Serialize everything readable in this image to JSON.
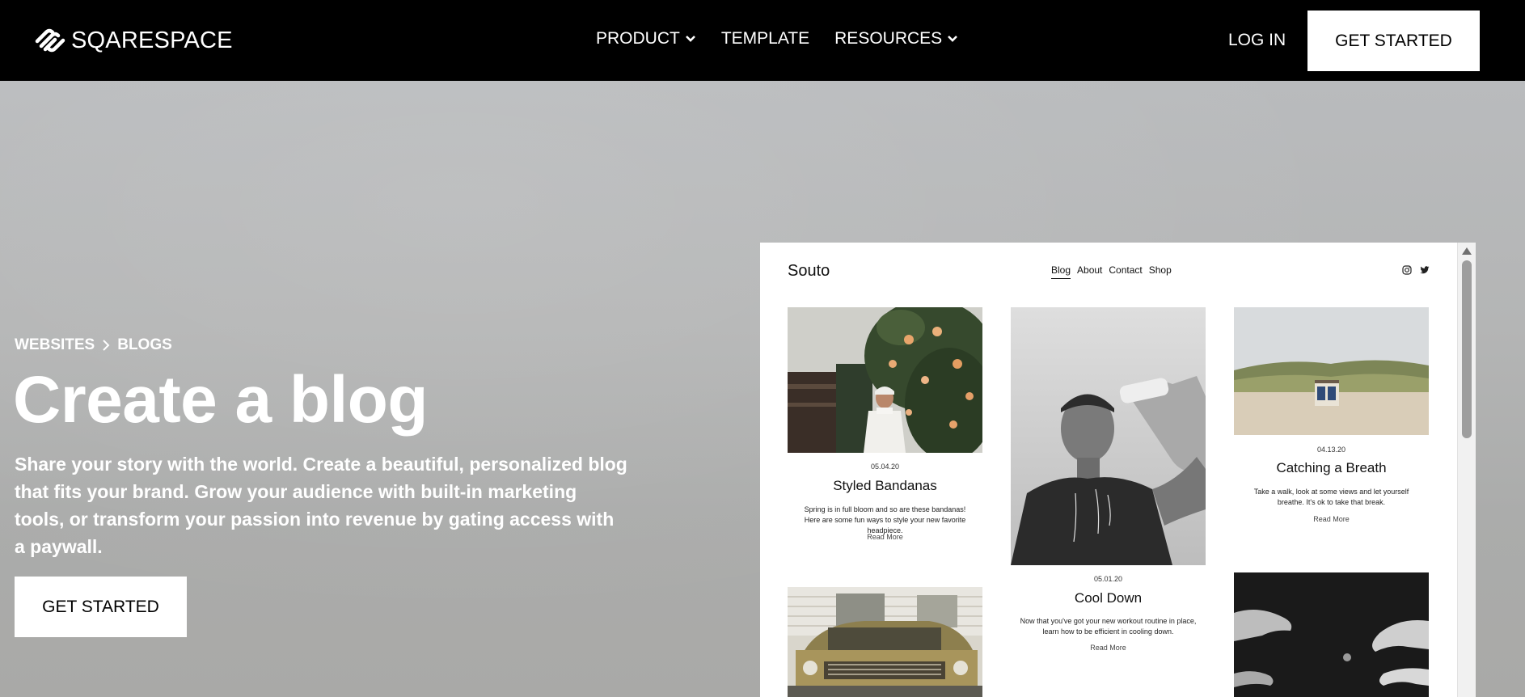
{
  "brand": {
    "name": "SQARESPACE"
  },
  "nav": {
    "items": [
      {
        "label": "PRODUCT",
        "has_dropdown": true
      },
      {
        "label": "TEMPLATE",
        "has_dropdown": false
      },
      {
        "label": "RESOURCES",
        "has_dropdown": true
      }
    ],
    "login_label": "LOG IN",
    "cta_label": "GET STARTED"
  },
  "hero": {
    "breadcrumb": [
      "WEBSITES",
      "BLOGS"
    ],
    "title": "Create a blog",
    "description": "Share your story with the world. Create a beautiful, personalized blog that fits your brand. Grow your audience with built-in marketing tools, or transform your passion into revenue by gating access with a paywall.",
    "cta_label": "GET STARTED"
  },
  "preview": {
    "site_name": "Souto",
    "nav": [
      "Blog",
      "About",
      "Contact",
      "Shop"
    ],
    "active_nav": "Blog",
    "social_icons": [
      "instagram-icon",
      "twitter-icon"
    ],
    "posts": [
      {
        "date": "05.04.20",
        "title": "Styled Bandanas",
        "excerpt_1": "Spring is in full bloom and so are these bandanas!",
        "excerpt_2": "Here are some fun ways to style your new favorite headpiece.",
        "more": "Read More"
      },
      {
        "date": "05.01.20",
        "title": "Cool Down",
        "excerpt_1": "Now that you've got your new workout routine in place,",
        "excerpt_2": "learn how to be efficient in cooling down.",
        "more": "Read More"
      },
      {
        "date": "04.13.20",
        "title": "Catching a Breath",
        "excerpt_1": "Take a walk, look at some views and let yourself",
        "excerpt_2": "breathe. It's ok to take that break.",
        "more": "Read More"
      }
    ]
  },
  "colors": {
    "nav_bg": "#000000",
    "hero_bg": "#b4b5b5",
    "button_bg": "#ffffff",
    "text_light": "#ffffff"
  }
}
